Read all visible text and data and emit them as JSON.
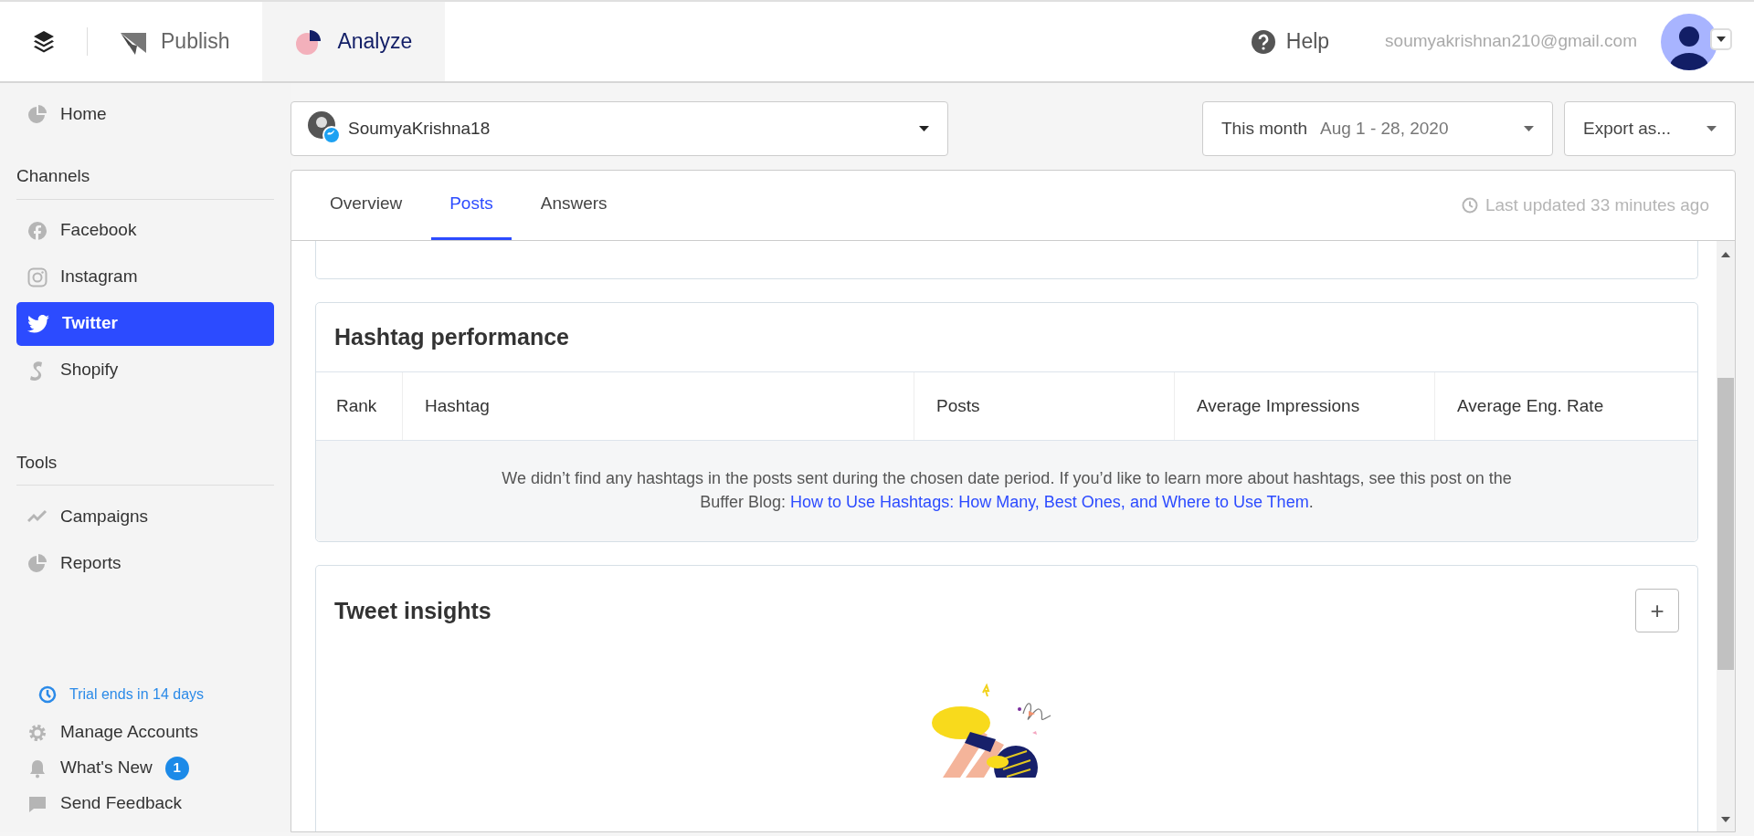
{
  "topbar": {
    "nav": [
      {
        "label": "Publish",
        "kind": "publish",
        "selected": false
      },
      {
        "label": "Analyze",
        "kind": "analyze",
        "selected": true
      }
    ],
    "help": "Help",
    "email": "soumyakrishnan210@gmail.com"
  },
  "sidebar": {
    "home": {
      "label": "Home",
      "kind": "pie",
      "selected": false
    },
    "sections": [
      {
        "title": "Channels",
        "items": [
          {
            "label": "Facebook",
            "kind": "facebook",
            "selected": false
          },
          {
            "label": "Instagram",
            "kind": "instagram",
            "selected": false
          },
          {
            "label": "Twitter",
            "kind": "twitter",
            "selected": true
          },
          {
            "label": "Shopify",
            "kind": "shopify",
            "selected": false
          }
        ]
      },
      {
        "title": "Tools",
        "items": [
          {
            "label": "Campaigns",
            "kind": "trend",
            "selected": false
          },
          {
            "label": "Reports",
            "kind": "pie",
            "selected": false
          }
        ]
      }
    ],
    "trial": "Trial ends in 14 days",
    "bottom_items": [
      {
        "label": "Manage Accounts",
        "kind": "gear"
      },
      {
        "label": "What's New",
        "kind": "bell",
        "badge": "1"
      },
      {
        "label": "Send Feedback",
        "kind": "chat"
      }
    ]
  },
  "profile_selector": {
    "name": "SoumyaKrishna18"
  },
  "date_picker": {
    "label": "This month",
    "range": "Aug 1 - 28, 2020"
  },
  "export": {
    "label": "Export as..."
  },
  "tabs": [
    {
      "label": "Overview",
      "selected": false
    },
    {
      "label": "Posts",
      "selected": true
    },
    {
      "label": "Answers",
      "selected": false
    }
  ],
  "last_updated": "Last updated 33 minutes ago",
  "hashtag_performance": {
    "title": "Hashtag performance",
    "columns": [
      "Rank",
      "Hashtag",
      "Posts",
      "Average Impressions",
      "Average Eng. Rate"
    ],
    "empty_message": "We didn’t find any hashtags in the posts sent during the chosen date period. If you’d like to learn more about hashtags, see this post on the Buffer Blog: ",
    "link": "How to Use Hashtags: How Many, Best Ones, and Where to Use Them",
    "message_end": "."
  },
  "tweet_insights": {
    "title": "Tweet insights",
    "add_button": "+"
  }
}
